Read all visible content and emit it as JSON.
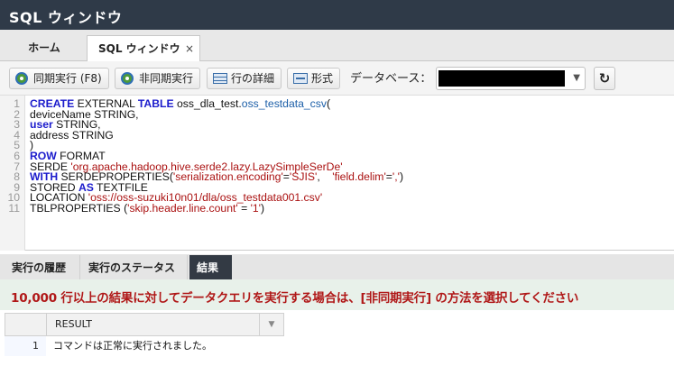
{
  "window": {
    "title": "SQL ウィンドウ"
  },
  "tabs": [
    {
      "label": "ホーム"
    },
    {
      "label": "SQL ウィンドウ",
      "close": "×"
    }
  ],
  "toolbar": {
    "sync_execute": "同期実行 (F8)",
    "async_execute": "非同期実行",
    "row_detail": "行の詳細",
    "format": "形式",
    "database_label": "データベース：",
    "refresh_icon": "↻"
  },
  "editor": {
    "line_numbers": [
      "1",
      "2",
      "3",
      "4",
      "5",
      "6",
      "7",
      "8",
      "9",
      "10",
      "11"
    ]
  },
  "result_tabs": {
    "history": "実行の履歴",
    "status": "実行のステータス",
    "result": "結果"
  },
  "notice": "10,000 行以上の結果に対してデータクエリを実行する場合は、[非同期実行] の方法を選択してください",
  "result_grid": {
    "column": "RESULT",
    "rows": [
      {
        "index": "1",
        "value": "コマンドは正常に実行されました。"
      }
    ]
  },
  "colors": {
    "titlebar": "#2f3a48",
    "keyword": "#1c1ccc",
    "string": "#aa1111",
    "notice_text": "#b01818"
  }
}
